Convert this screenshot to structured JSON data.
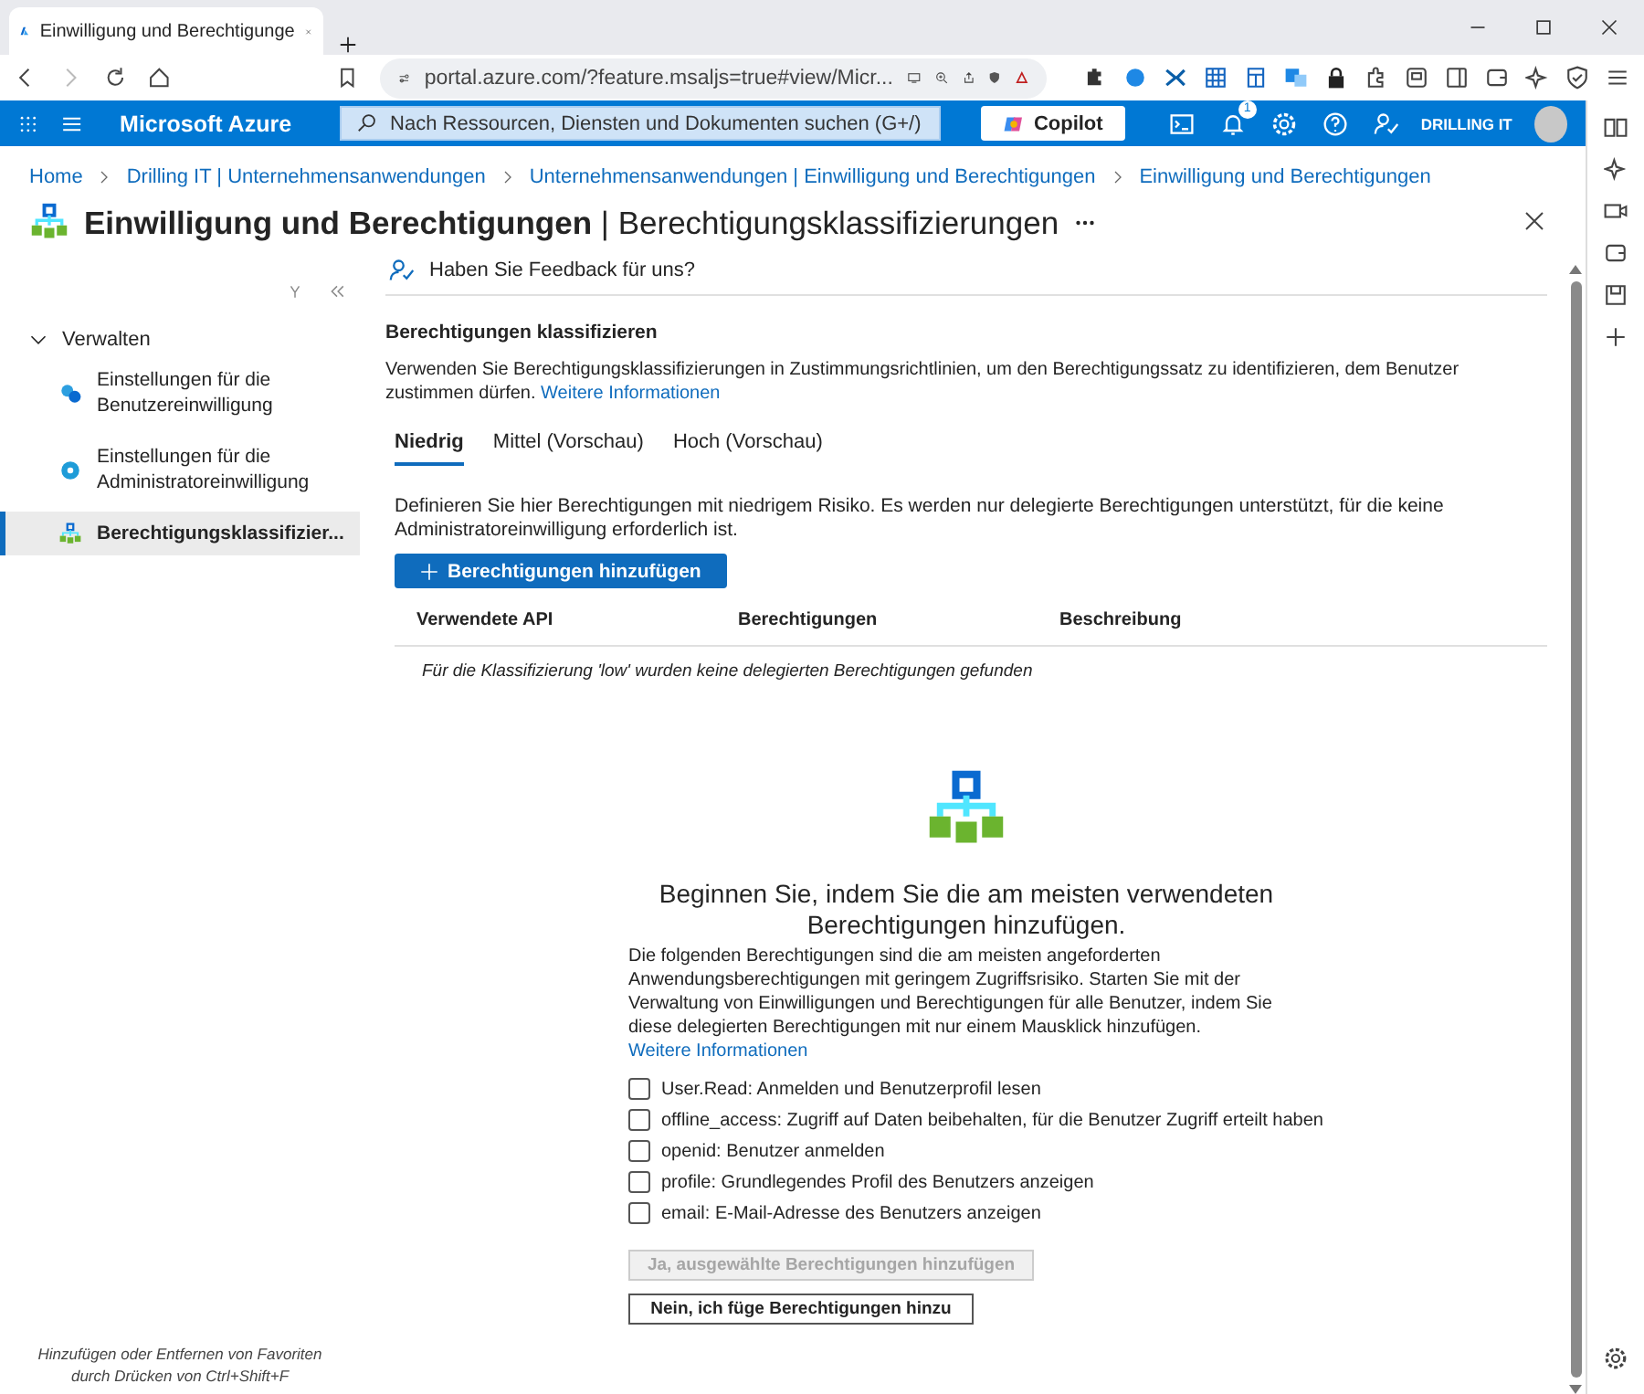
{
  "browser": {
    "tab_title": "Einwilligung und Berechtigunge",
    "address": "portal.azure.com/?feature.msaljs=true#view/Micr..."
  },
  "header": {
    "brand": "Microsoft Azure",
    "search": {
      "placeholder": "Nach Ressourcen, Diensten und Dokumenten suchen (G+/)"
    },
    "copilot": "Copilot",
    "notification_count": "1",
    "account": "DRILLING IT"
  },
  "breadcrumb": [
    "Home",
    "Drilling IT | Unternehmensanwendungen",
    "Unternehmensanwendungen | Einwilligung und Berechtigungen",
    "Einwilligung und Berechtigungen"
  ],
  "page": {
    "title": "Einwilligung und Berechtigungen",
    "separator": "|",
    "subtitle": "Berechtigungsklassifizierungen"
  },
  "sidebar": {
    "group": "Verwalten",
    "expanded": true,
    "items": [
      {
        "label": "Einstellungen für die Benutzereinwilligung",
        "kind": "user",
        "selected": false
      },
      {
        "label": "Einstellungen für die Administratoreinwilligung",
        "kind": "admin",
        "selected": false
      },
      {
        "label": "Berechtigungsklassifizier...",
        "kind": "tree",
        "selected": true
      }
    ]
  },
  "feedback": "Haben Sie Feedback für uns?",
  "section": {
    "title": "Berechtigungen klassifizieren",
    "description": "Verwenden Sie Berechtigungsklassifizierungen in Zustimmungsrichtlinien, um den Berechtigungssatz zu identifizieren, dem Benutzer zustimmen dürfen.",
    "link": "Weitere Informationen"
  },
  "tabs": [
    {
      "label": "Niedrig",
      "selected": true
    },
    {
      "label": "Mittel (Vorschau)",
      "selected": false
    },
    {
      "label": "Hoch (Vorschau)",
      "selected": false
    }
  ],
  "tab_description": "Definieren Sie hier Berechtigungen mit niedrigem Risiko. Es werden nur delegierte Berechtigungen unterstützt, für die keine Administratoreinwilligung erforderlich ist.",
  "add_button": "Berechtigungen hinzufügen",
  "table": {
    "columns": [
      "Verwendete API",
      "Berechtigungen",
      "Beschreibung"
    ],
    "empty_message": "Für die Klassifizierung 'low' wurden keine delegierten Berechtigungen gefunden"
  },
  "empty_state": {
    "heading": "Beginnen Sie, indem Sie die am meisten verwendeten Berechtigungen hinzufügen.",
    "body": "Die folgenden Berechtigungen sind die am meisten angeforderten Anwendungsberechtigungen mit geringem Zugriffsrisiko. Starten Sie mit der Verwaltung von Einwilligungen und Berechtigungen für alle Benutzer, indem Sie diese delegierten Berechtigungen mit nur einem Mausklick hinzufügen.",
    "link": "Weitere Informationen"
  },
  "permissions": [
    {
      "label": "User.Read: Anmelden und Benutzerprofil lesen",
      "checked": false
    },
    {
      "label": "offline_access: Zugriff auf Daten beibehalten, für die Benutzer Zugriff erteilt haben",
      "checked": false
    },
    {
      "label": "openid: Benutzer anmelden",
      "checked": false
    },
    {
      "label": "profile: Grundlegendes Profil des Benutzers anzeigen",
      "checked": false
    },
    {
      "label": "email: E-Mail-Adresse des Benutzers anzeigen",
      "checked": false
    }
  ],
  "actions": [
    {
      "label": "Ja, ausgewählte Berechtigungen hinzufügen",
      "disabled": true
    },
    {
      "label": "Nein, ich füge Berechtigungen hinzu",
      "disabled": false
    }
  ],
  "favorites_hint": "Hinzufügen oder Entfernen von Favoriten durch Drücken von Ctrl+Shift+F"
}
